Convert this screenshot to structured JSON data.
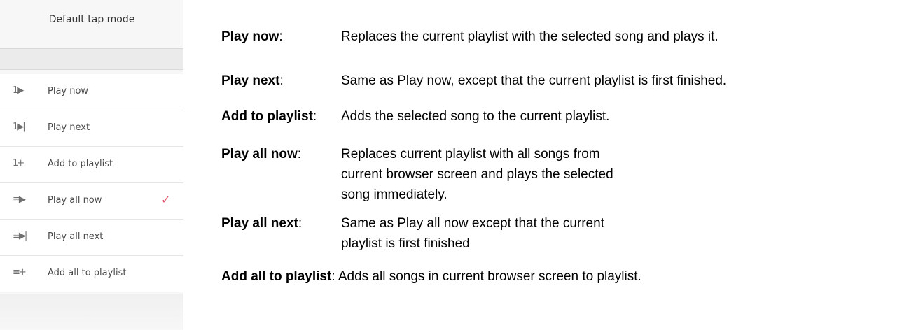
{
  "menu": {
    "title": "Default tap mode",
    "items": [
      {
        "icon": "1▶",
        "icon_name": "play-now-icon",
        "label": "Play now",
        "checked": false
      },
      {
        "icon": "1▶|",
        "icon_name": "play-next-icon",
        "label": "Play next",
        "checked": false
      },
      {
        "icon": "1+",
        "icon_name": "add-to-playlist-icon",
        "label": "Add to playlist",
        "checked": false
      },
      {
        "icon": "≡▶",
        "icon_name": "play-all-now-icon",
        "label": "Play all now",
        "checked": true
      },
      {
        "icon": "≡▶|",
        "icon_name": "play-all-next-icon",
        "label": "Play all next",
        "checked": false
      },
      {
        "icon": "≡+",
        "icon_name": "add-all-to-playlist-icon",
        "label": "Add all to playlist",
        "checked": false
      }
    ],
    "check_mark": "✓",
    "accent_color": "#e8556b"
  },
  "descriptions": [
    {
      "term": "Play now",
      "colon": ":",
      "text": "Replaces the current playlist with the selected song and plays it."
    },
    {
      "term": "Play next",
      "colon": ":",
      "text": "Same as Play now, except that the current playlist is first finished."
    },
    {
      "term": "Add to playlist",
      "colon": ":",
      "text": "Adds the selected song to the current playlist."
    },
    {
      "term": "Play all now",
      "colon": ":",
      "text": "Replaces current playlist with all songs from current browser screen and plays the selected song immediately."
    },
    {
      "term": "Play all next",
      "colon": ":",
      "text": "Same as Play all now except that the current playlist is first finished"
    },
    {
      "term": "Add all to playlist",
      "colon": ":",
      "text": "Adds all songs in current browser screen to playlist."
    }
  ]
}
